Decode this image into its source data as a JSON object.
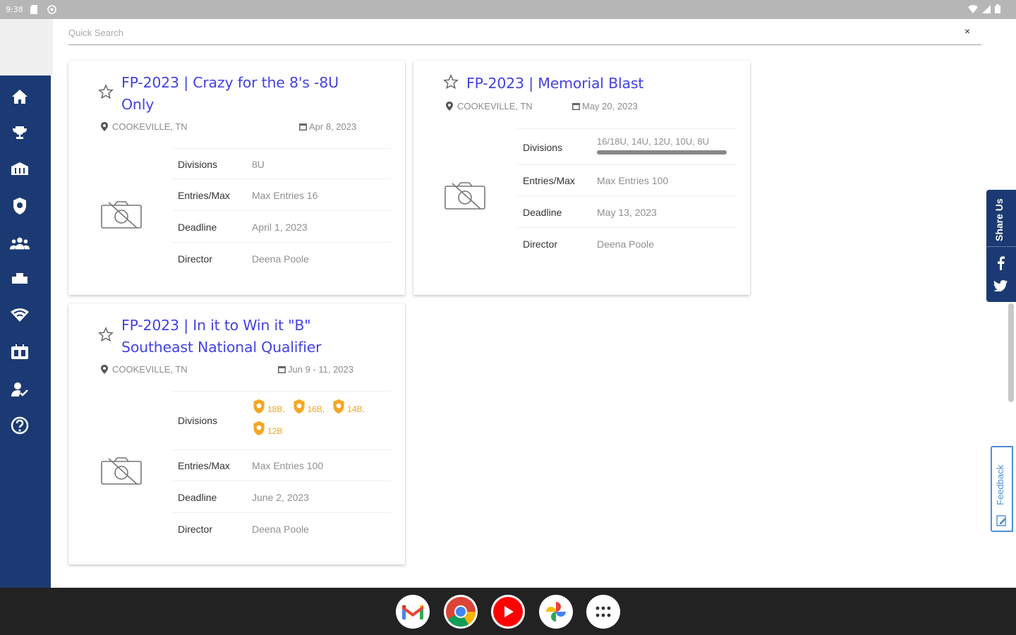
{
  "status_bar": {
    "time": "9:38"
  },
  "search": {
    "placeholder": "Quick Search",
    "clear": "×"
  },
  "sidebar": {
    "items": [
      {
        "icon": "home-icon"
      },
      {
        "icon": "trophy-icon"
      },
      {
        "icon": "stadium-icon"
      },
      {
        "icon": "shield-icon"
      },
      {
        "icon": "team-icon"
      },
      {
        "icon": "bus-icon"
      },
      {
        "icon": "wifi-icon"
      },
      {
        "icon": "scoreboard-icon"
      },
      {
        "icon": "user-check-icon"
      },
      {
        "icon": "help-icon"
      }
    ]
  },
  "labels": {
    "divisions": "Divisions",
    "entries": "Entries/Max",
    "deadline": "Deadline",
    "director": "Director"
  },
  "events": [
    {
      "title_line1": "FP-2023 | Crazy for the 8's -8U",
      "title_line2": "Only",
      "location": "COOKEVILLE, TN",
      "date": "Apr 8, 2023",
      "divisions": "8U",
      "entries": "Max Entries 16",
      "deadline": "April 1, 2023",
      "director": "Deena Poole"
    },
    {
      "title_line1": "FP-2023 | Memorial Blast",
      "location": "COOKEVILLE, TN",
      "date": "May 20, 2023",
      "divisions": "16/18U, 14U, 12U, 10U, 8U",
      "entries": "Max Entries 100",
      "deadline": "May 13, 2023",
      "director": "Deena Poole"
    },
    {
      "title_line1": "FP-2023 | In it to Win it \"B\"",
      "title_line2": "Southeast National Qualifier",
      "location": "COOKEVILLE, TN",
      "date": "Jun 9 - 11, 2023",
      "division_badges": [
        "18B",
        "16B",
        "14B",
        "12B"
      ],
      "entries": "Max Entries 100",
      "deadline": "June 2, 2023",
      "director": "Deena Poole"
    }
  ],
  "share": {
    "label": "Share Us"
  },
  "feedback": {
    "label": "Feedback"
  },
  "colors": {
    "nav": "#1b3a73",
    "title": "#4343e0",
    "badge": "#f5a623"
  }
}
